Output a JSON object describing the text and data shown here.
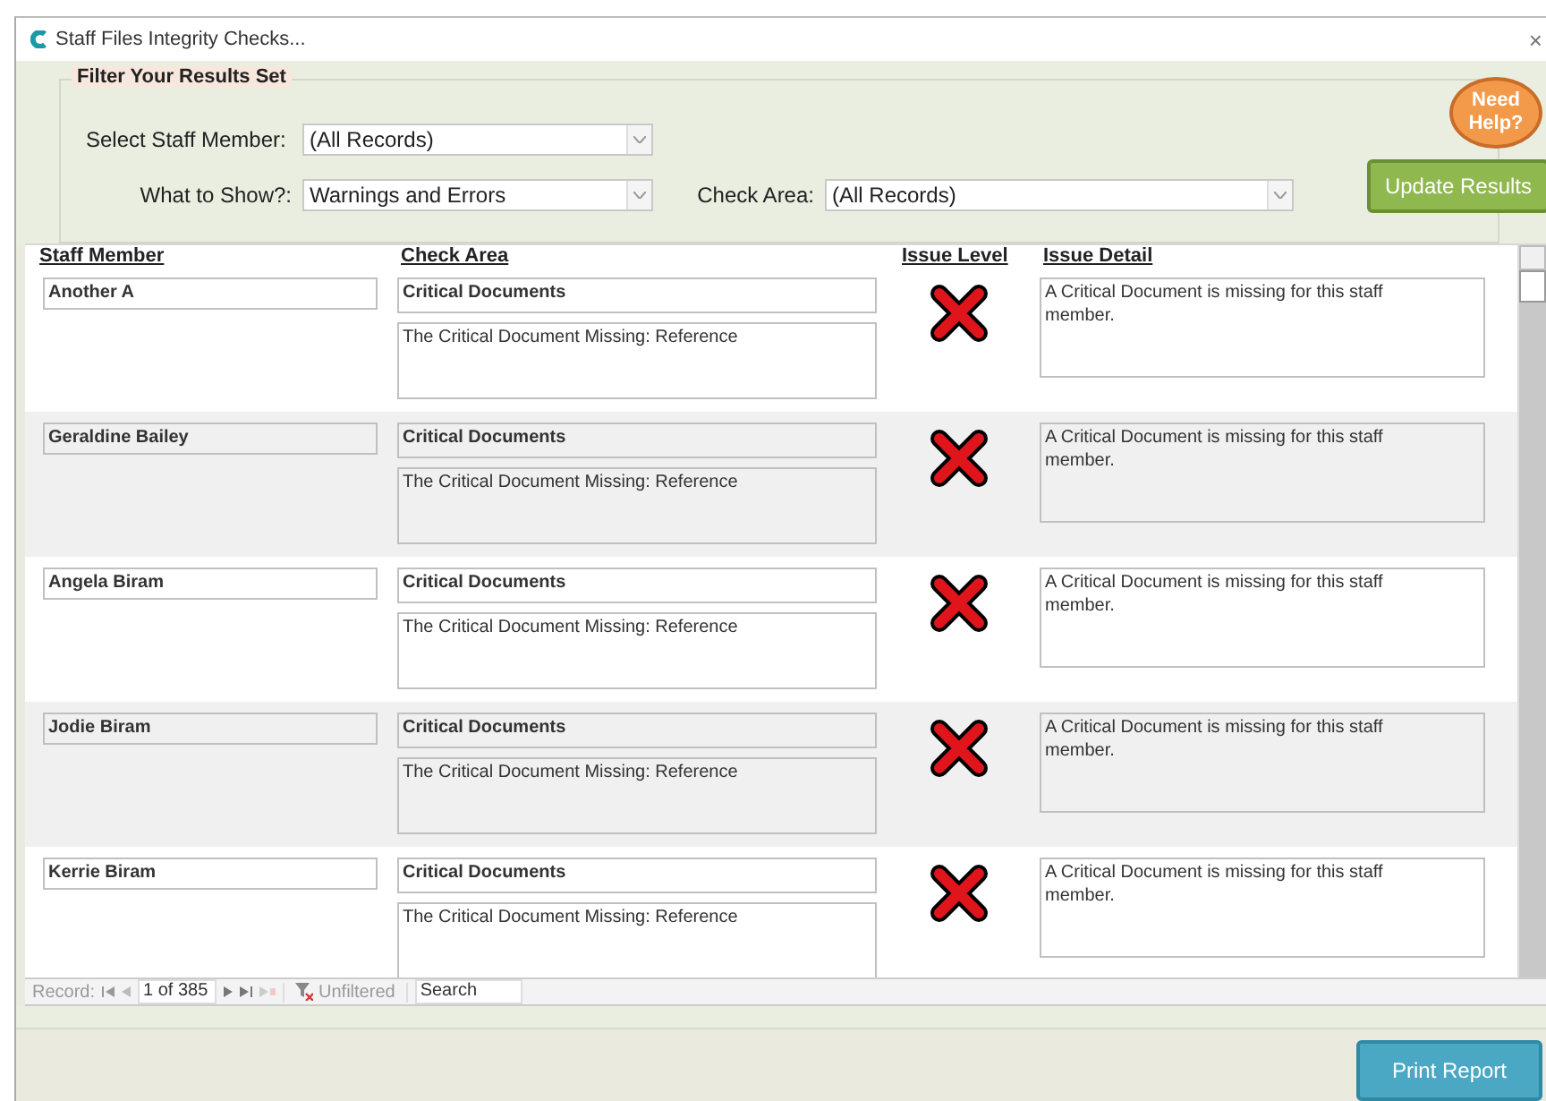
{
  "window": {
    "title": "Staff Files Integrity Checks...",
    "close": "×"
  },
  "filter": {
    "legend": "Filter Your Results Set",
    "staff_label": "Select Staff Member:",
    "staff_value": "(All Records)",
    "show_label": "What to Show?:",
    "show_value": "Warnings and Errors",
    "area_label": "Check Area:",
    "area_value": "(All Records)",
    "help": "Need Help?",
    "update": "Update Results"
  },
  "table": {
    "columns": [
      "Staff Member",
      "Check Area",
      "Issue Level",
      "Issue Detail"
    ],
    "rows": [
      {
        "name": "Another A",
        "area": "Critical Documents",
        "check": "The Critical Document Missing: Reference",
        "kind": "error",
        "detail": "A Critical Document is missing for this staff member."
      },
      {
        "name": "Geraldine Bailey",
        "area": "Critical Documents",
        "check": "The Critical Document Missing: Reference",
        "kind": "error",
        "detail": "A Critical Document is missing for this staff member."
      },
      {
        "name": "Angela Biram",
        "area": "Critical Documents",
        "check": "The Critical Document Missing: Reference",
        "kind": "error",
        "detail": "A Critical Document is missing for this staff member."
      },
      {
        "name": "Jodie Biram",
        "area": "Critical Documents",
        "check": "The Critical Document Missing: Reference",
        "kind": "error",
        "detail": "A Critical Document is missing for this staff member."
      },
      {
        "name": "Kerrie Biram",
        "area": "Critical Documents",
        "check": "The Critical Document Missing: Reference",
        "kind": "error",
        "detail": "A Critical Document is missing for this staff member."
      }
    ]
  },
  "navigation": {
    "label": "Record:",
    "position": "1 of 385",
    "filter": "Unfiltered",
    "search": "Search"
  },
  "footer": {
    "print": "Print Report"
  }
}
